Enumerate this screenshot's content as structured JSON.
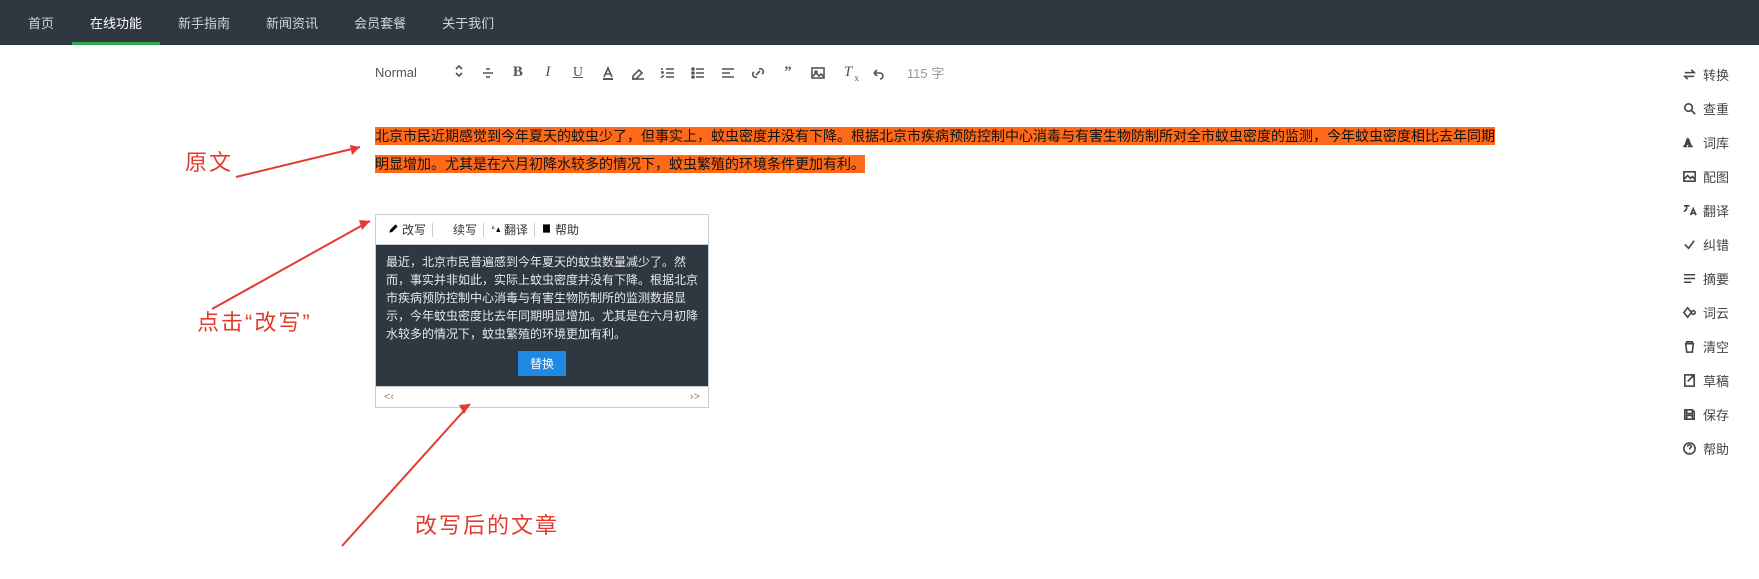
{
  "nav": {
    "items": [
      {
        "label": "首页"
      },
      {
        "label": "在线功能",
        "active": true
      },
      {
        "label": "新手指南"
      },
      {
        "label": "新闻资讯"
      },
      {
        "label": "会员套餐"
      },
      {
        "label": "关于我们"
      }
    ]
  },
  "toolbar": {
    "normal_label": "Normal",
    "word_count": "115 字"
  },
  "original_text": "北京市民近期感觉到今年夏天的蚊虫少了，但事实上，蚊虫密度并没有下降。根据北京市疾病预防控制中心消毒与有害生物防制所对全市蚊虫密度的监测，今年蚊虫密度相比去年同期明显增加。尤其是在六月初降水较多的情况下，蚊虫繁殖的环境条件更加有利。",
  "popup": {
    "actions": {
      "rewrite": "改写",
      "continue": "续写",
      "translate": "翻译",
      "help": "帮助"
    },
    "body": "最近，北京市民普遍感到今年夏天的蚊虫数量减少了。然而，事实并非如此，实际上蚊虫密度并没有下降。根据北京市疾病预防控制中心消毒与有害生物防制所的监测数据显示，今年蚊虫密度比去年同期明显增加。尤其是在六月初降水较多的情况下，蚊虫繁殖的环境更加有利。",
    "replace_label": "替换",
    "prev": "<‹",
    "next": "›>"
  },
  "sidebar": {
    "items": [
      {
        "label": "转换"
      },
      {
        "label": "查重"
      },
      {
        "label": "词库"
      },
      {
        "label": "配图"
      },
      {
        "label": "翻译"
      },
      {
        "label": "纠错"
      },
      {
        "label": "摘要"
      },
      {
        "label": "词云"
      },
      {
        "label": "清空"
      },
      {
        "label": "草稿"
      },
      {
        "label": "保存"
      },
      {
        "label": "帮助"
      }
    ]
  },
  "annotations": {
    "label_original": "原文",
    "label_click_rewrite": "点击“改写”",
    "label_after_rewrite": "改写后的文章"
  }
}
